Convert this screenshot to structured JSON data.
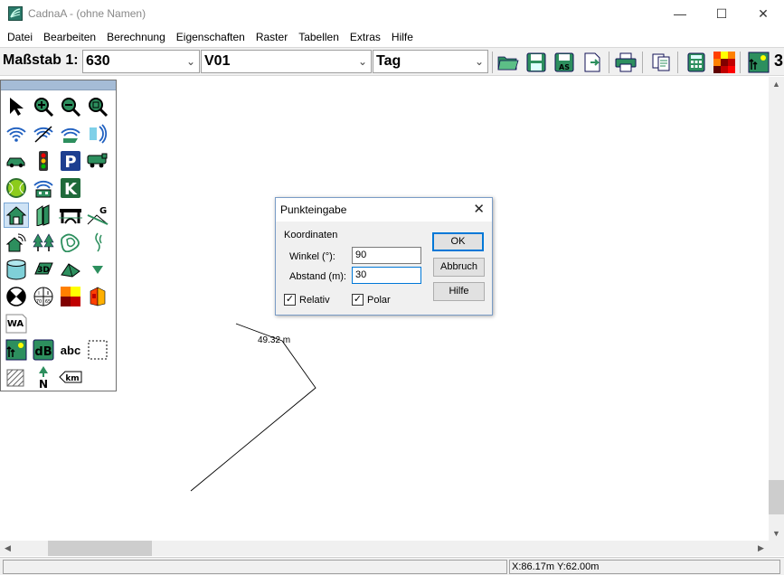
{
  "window": {
    "title": "CadnaA - (ohne Namen)",
    "minimize": "—",
    "maximize": "☐",
    "close": "✕"
  },
  "menu": [
    "Datei",
    "Bearbeiten",
    "Berechnung",
    "Eigenschaften",
    "Raster",
    "Tabellen",
    "Extras",
    "Hilfe"
  ],
  "toolbar": {
    "scale_label": "Maßstab 1:",
    "scale_value": "630",
    "variant_value": "V01",
    "period_value": "Tag",
    "truncated_text": "3"
  },
  "canvas": {
    "dimension_label": "49.32 m"
  },
  "status": {
    "left": "",
    "coordinates": "X:86.17m Y:62.00m"
  },
  "dialog": {
    "title": "Punkteingabe",
    "close": "✕",
    "group_label": "Koordinaten",
    "angle_label": "Winkel (°):",
    "angle_value": "90",
    "distance_label": "Abstand (m):",
    "distance_value": "30",
    "relative_label": "Relativ",
    "relative_checked": "✓",
    "polar_label": "Polar",
    "polar_checked": "✓",
    "ok_label": "OK",
    "cancel_label": "Abbruch",
    "help_label": "Hilfe"
  },
  "palette_icons": [
    "pointer-icon",
    "zoom-in-icon",
    "zoom-out-icon",
    "zoom-window-icon",
    "point-source-icon",
    "line-source-icon",
    "area-source-icon",
    "vertical-area-source-icon",
    "road-icon",
    "traffic-light-icon",
    "parking-lot-icon",
    "railway-icon",
    "tennis-icon",
    "industrial-building-icon",
    "k-object-icon",
    "building-icon",
    "barrier-icon",
    "bridge-icon",
    "embankment-icon",
    "building-evaluation-icon",
    "vegetation-icon",
    "contour-line-icon",
    "height-point-icon",
    "cylinder-icon",
    "3d-reflector-icon",
    "terrain-icon",
    "triangle-icon",
    "receiver-icon",
    "grid-icon",
    "noise-map-icon",
    "facade-map-icon",
    "land-use-icon",
    "bitmap-icon",
    "db-icon",
    "text-icon",
    "auxiliary-polygon-icon",
    "hatch-icon",
    "north-arrow-icon",
    "km-marker-icon"
  ],
  "palette_labels": {
    "parking": "P",
    "k_object": "K",
    "3d": "3D",
    "land_use": "WA",
    "db": "dB",
    "text": "abc",
    "km": "km",
    "north": "N"
  }
}
